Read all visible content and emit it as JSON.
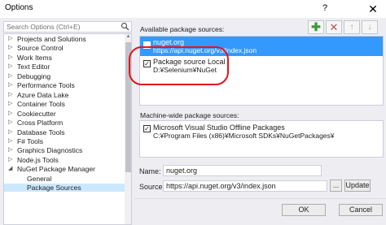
{
  "window": {
    "title": "Options",
    "help_glyph": "?",
    "close_glyph": "✕"
  },
  "search": {
    "placeholder": "Search Options (Ctrl+E)",
    "icon": "search-icon"
  },
  "tree": {
    "items": [
      {
        "label": "Projects and Solutions",
        "expander": "▷",
        "level": 0
      },
      {
        "label": "Source Control",
        "expander": "▷",
        "level": 0
      },
      {
        "label": "Work Items",
        "expander": "▷",
        "level": 0
      },
      {
        "label": "Text Editor",
        "expander": "▷",
        "level": 0
      },
      {
        "label": "Debugging",
        "expander": "▷",
        "level": 0
      },
      {
        "label": "Performance Tools",
        "expander": "▷",
        "level": 0
      },
      {
        "label": "Azure Data Lake",
        "expander": "▷",
        "level": 0
      },
      {
        "label": "Container Tools",
        "expander": "▷",
        "level": 0
      },
      {
        "label": "Cookiecutter",
        "expander": "▷",
        "level": 0
      },
      {
        "label": "Cross Platform",
        "expander": "▷",
        "level": 0
      },
      {
        "label": "Database Tools",
        "expander": "▷",
        "level": 0
      },
      {
        "label": "F# Tools",
        "expander": "▷",
        "level": 0
      },
      {
        "label": "Graphics Diagnostics",
        "expander": "▷",
        "level": 0
      },
      {
        "label": "Node.js Tools",
        "expander": "▷",
        "level": 0
      },
      {
        "label": "NuGet Package Manager",
        "expander": "◢",
        "level": 0
      },
      {
        "label": "General",
        "expander": "",
        "level": 1
      },
      {
        "label": "Package Sources",
        "expander": "",
        "level": 1,
        "selected": true
      }
    ]
  },
  "available": {
    "label": "Available package sources:",
    "toolbar": {
      "add_glyph": "✚",
      "remove_glyph": "✕",
      "up_glyph": "↑",
      "down_glyph": "↓"
    },
    "sources": [
      {
        "name": "nuget.org",
        "url": "https://api.nuget.org/v3/index.json",
        "checked": false,
        "selected": true
      },
      {
        "name": "Package source Local",
        "url": "D:¥Selenium¥NuGet",
        "checked": true,
        "selected": false
      }
    ]
  },
  "machine_wide": {
    "label": "Machine-wide package sources:",
    "sources": [
      {
        "name": "Microsoft Visual Studio Offline Packages",
        "url": "C:¥Program Files (x86)¥Microsoft SDKs¥NuGetPackages¥",
        "checked": true
      }
    ]
  },
  "form": {
    "name_label": "Name:",
    "name_value": "nuget.org",
    "source_label": "Source:",
    "source_value": "https://api.nuget.org/v3/index.json",
    "browse_label": "...",
    "update_label": "Update"
  },
  "footer": {
    "ok_label": "OK",
    "cancel_label": "Cancel"
  },
  "colors": {
    "selection": "#3399ff",
    "tree_selection": "#cce8ff",
    "highlight": "#e2151c",
    "add": "#3a9a3a",
    "remove": "#c0504d"
  }
}
